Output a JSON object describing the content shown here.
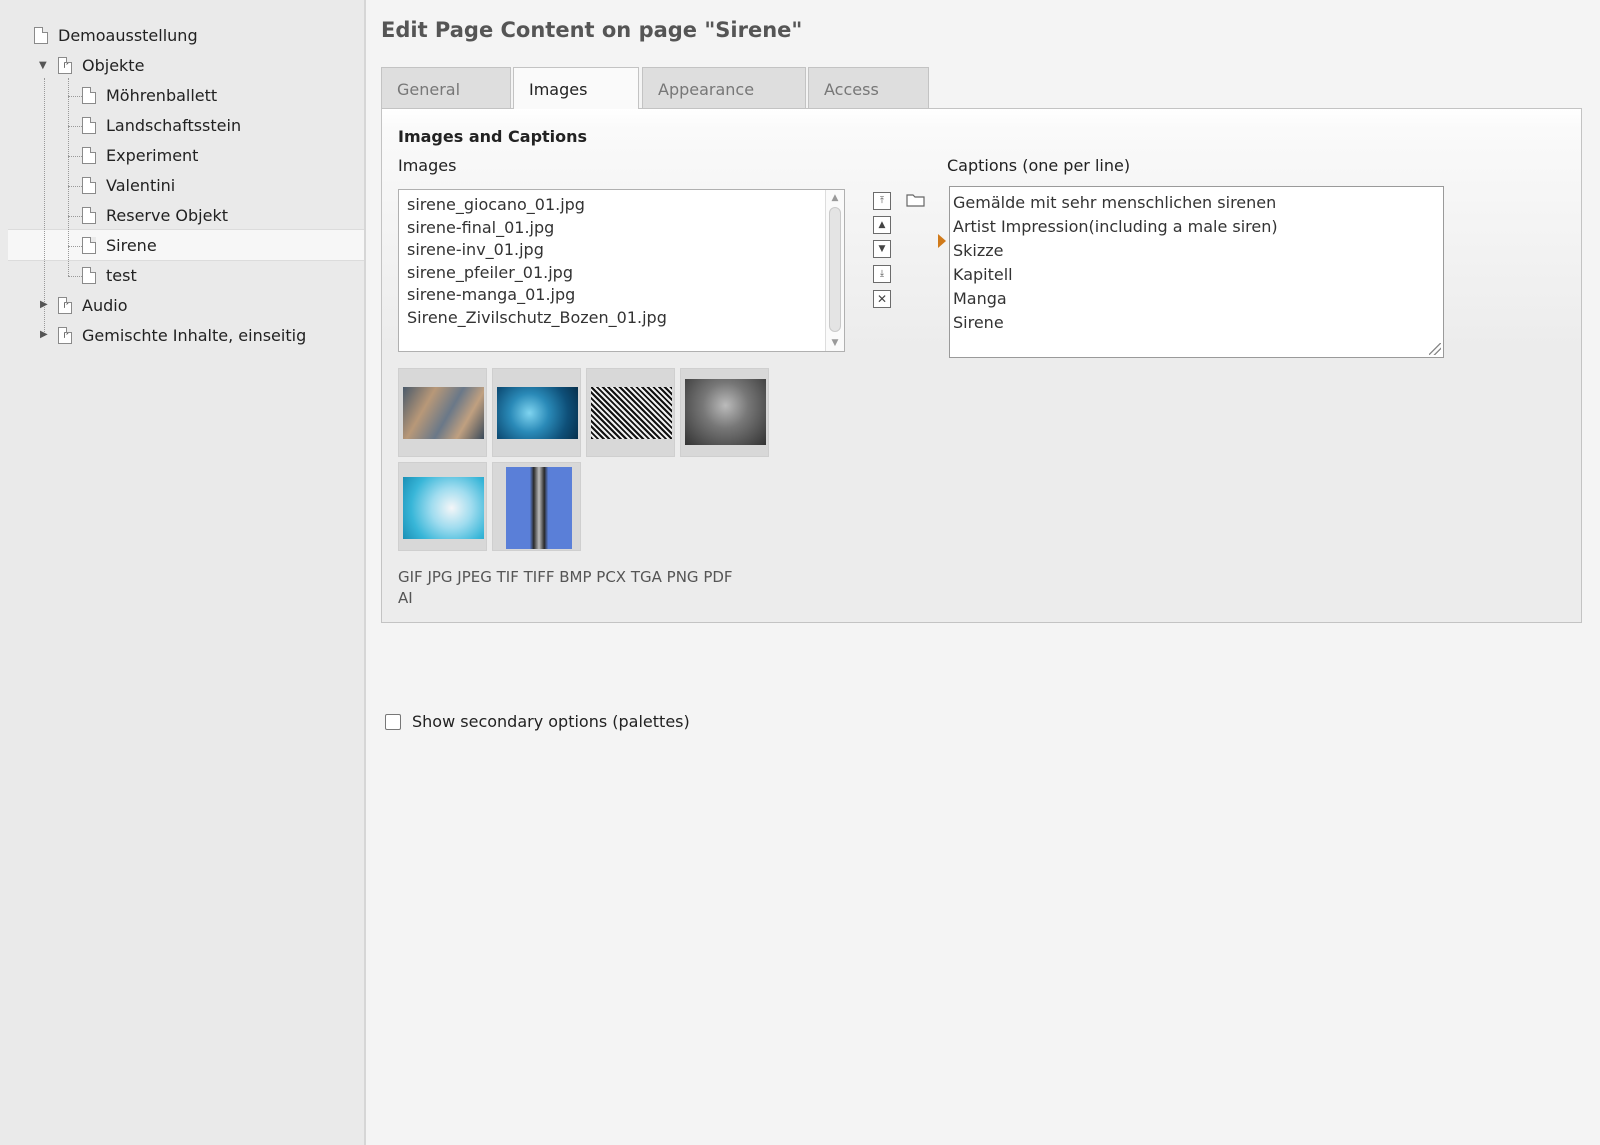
{
  "tree": {
    "root": {
      "label": "Demoausstellung"
    },
    "objekte": {
      "label": "Objekte"
    },
    "children": [
      {
        "label": "Möhrenballett"
      },
      {
        "label": "Landschaftsstein"
      },
      {
        "label": "Experiment"
      },
      {
        "label": "Valentini"
      },
      {
        "label": "Reserve Objekt"
      },
      {
        "label": "Sirene"
      },
      {
        "label": "test"
      }
    ],
    "audio": {
      "label": "Audio"
    },
    "gemischte": {
      "label": "Gemischte Inhalte, einseitig"
    }
  },
  "main": {
    "heading": "Edit Page Content on page \"Sirene\"",
    "tabs": [
      {
        "label": "General"
      },
      {
        "label": "Images"
      },
      {
        "label": "Appearance"
      },
      {
        "label": "Access"
      }
    ],
    "section_title": "Images and Captions",
    "images_label": "Images",
    "captions_label": "Captions (one per line)",
    "files": [
      "sirene_giocano_01.jpg",
      "sirene-final_01.jpg",
      "sirene-inv_01.jpg",
      "sirene_pfeiler_01.jpg",
      "sirene-manga_01.jpg",
      "Sirene_Zivilschutz_Bozen_01.jpg"
    ],
    "captions": [
      "Gemälde mit sehr menschlichen sirenen",
      "Artist Impression(including a male siren)",
      "Skizze",
      "Kapitell",
      "Manga",
      "Sirene"
    ],
    "formats_line1": "GIF JPG JPEG TIF TIFF BMP PCX TGA PNG PDF",
    "formats_line2": "AI",
    "secondary_options": "Show secondary options (palettes)"
  },
  "colors": {
    "tree_bg": "#eaeaea",
    "page_bg": "#f4f4f4",
    "marker": "#d07a1a"
  }
}
